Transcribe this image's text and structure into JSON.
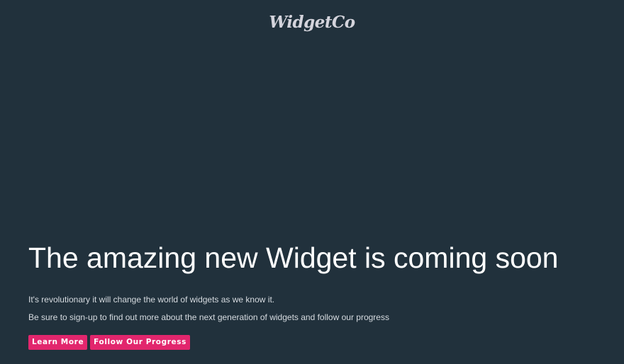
{
  "header": {
    "logo_text": "WidgetCo"
  },
  "hero": {
    "headline": "The amazing new Widget is coming soon",
    "description_1": "It's revolutionary it will change the world of widgets as we know it.",
    "description_2": "Be sure to sign-up to find out more about the next generation of widgets and follow our progress"
  },
  "buttons": {
    "learn_more": "Learn More",
    "follow_progress": "Follow Our Progress"
  },
  "colors": {
    "background": "#21313c",
    "accent": "#e2266d",
    "headline": "#ffffff",
    "body_text": "#d6dbe0",
    "logo": "#d4d4dc"
  }
}
